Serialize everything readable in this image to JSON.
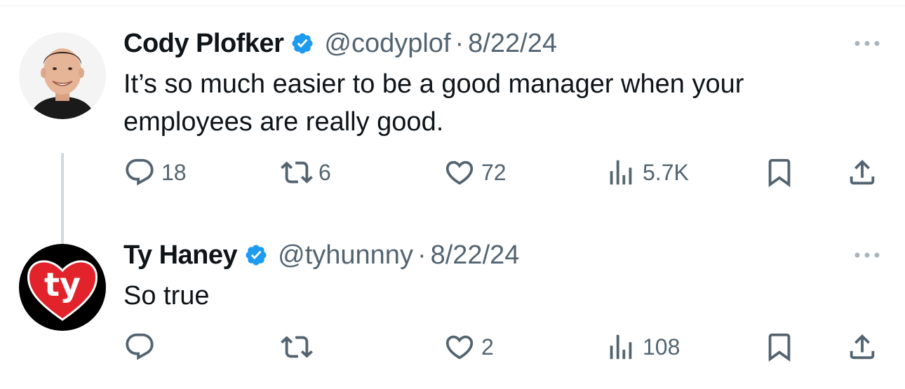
{
  "colors": {
    "verified": "#1d9bf0",
    "secondary_text": "#536471",
    "primary_text": "#0f1419",
    "thread_line": "#cfd9de"
  },
  "tweets": [
    {
      "name": "Cody Plofker",
      "handle": "@codyplof",
      "separator": "·",
      "date": "8/22/24",
      "verified": true,
      "text": "It’s so much easier to be a good manager when your employees are really good.",
      "avatar": "profile-photo",
      "replies": "18",
      "retweets": "6",
      "likes": "72",
      "views": "5.7K"
    },
    {
      "name": "Ty Haney",
      "handle": "@tyhunnny",
      "separator": "·",
      "date": "8/22/24",
      "verified": true,
      "text": "So true",
      "avatar": "ty-heart-logo",
      "avatar_logo_text": "ty",
      "replies": "",
      "retweets": "",
      "likes": "2",
      "views": "108"
    }
  ],
  "icons": {
    "reply": "reply-icon",
    "retweet": "retweet-icon",
    "like": "heart-icon",
    "views": "views-icon",
    "bookmark": "bookmark-icon",
    "share": "share-icon",
    "more": "more-icon",
    "verified": "verified-badge-icon"
  }
}
